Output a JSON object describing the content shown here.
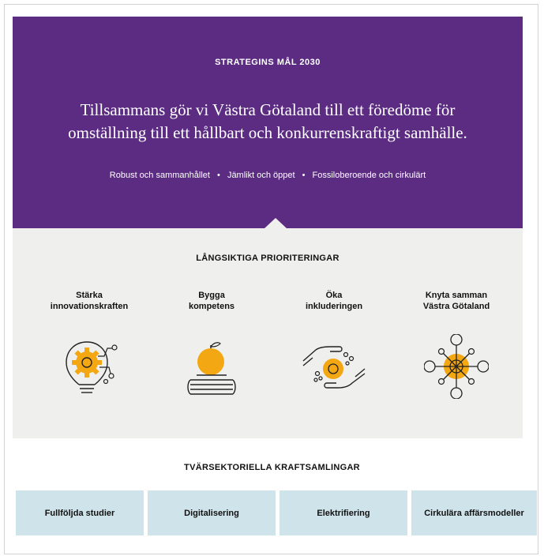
{
  "hero": {
    "kicker": "STRATEGINS MÅL 2030",
    "headline_line1": "Tillsammans gör vi Västra Götaland till ett föredöme för",
    "headline_line2": "omställning till ett hållbart och konkurrenskraftigt samhälle.",
    "values": [
      "Robust och sammanhållet",
      "Jämlikt och öppet",
      "Fossiloberoende och cirkulärt"
    ],
    "separator": "•"
  },
  "priorities": {
    "title": "LÅNGSIKTIGA PRIORITERINGAR",
    "items": [
      {
        "line1": "Stärka",
        "line2": "innovationskraften",
        "icon": "lightbulb-gear-icon"
      },
      {
        "line1": "Bygga",
        "line2": "kompetens",
        "icon": "apple-books-icon"
      },
      {
        "line1": "Öka",
        "line2": "inkluderingen",
        "icon": "hands-circle-icon"
      },
      {
        "line1": "Knyta samman",
        "line2": "Västra Götaland",
        "icon": "network-hub-icon"
      }
    ]
  },
  "kraftsamlingar": {
    "title": "TVÄRSEKTORIELLA KRAFTSAMLINGAR",
    "items": [
      "Fullföljda studier",
      "Digitalisering",
      "Elektrifiering",
      "Cirkulära affärsmodeller"
    ]
  },
  "colors": {
    "purple": "#5b2c82",
    "grey": "#efefee",
    "orange": "#f3a712",
    "box": "#cfe3ea"
  }
}
